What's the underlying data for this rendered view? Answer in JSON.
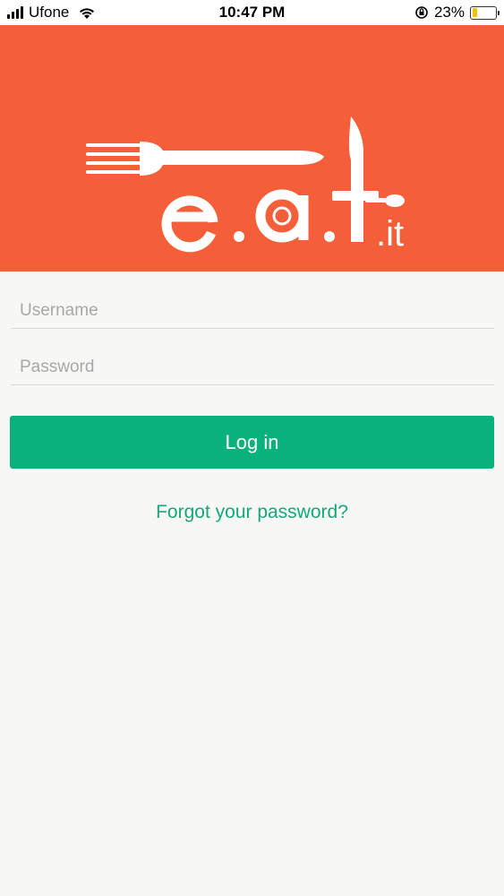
{
  "status_bar": {
    "carrier": "Ufone",
    "time": "10:47 PM",
    "battery_percent": "23%",
    "battery_level": 0.23,
    "battery_color": "#f2c200"
  },
  "banner": {
    "background": "#f45e38",
    "logo_text": "e.a.t.it"
  },
  "form": {
    "username_placeholder": "Username",
    "password_placeholder": "Password",
    "login_label": "Log in",
    "forgot_label": "Forgot your password?",
    "accent": "#08b27a"
  }
}
